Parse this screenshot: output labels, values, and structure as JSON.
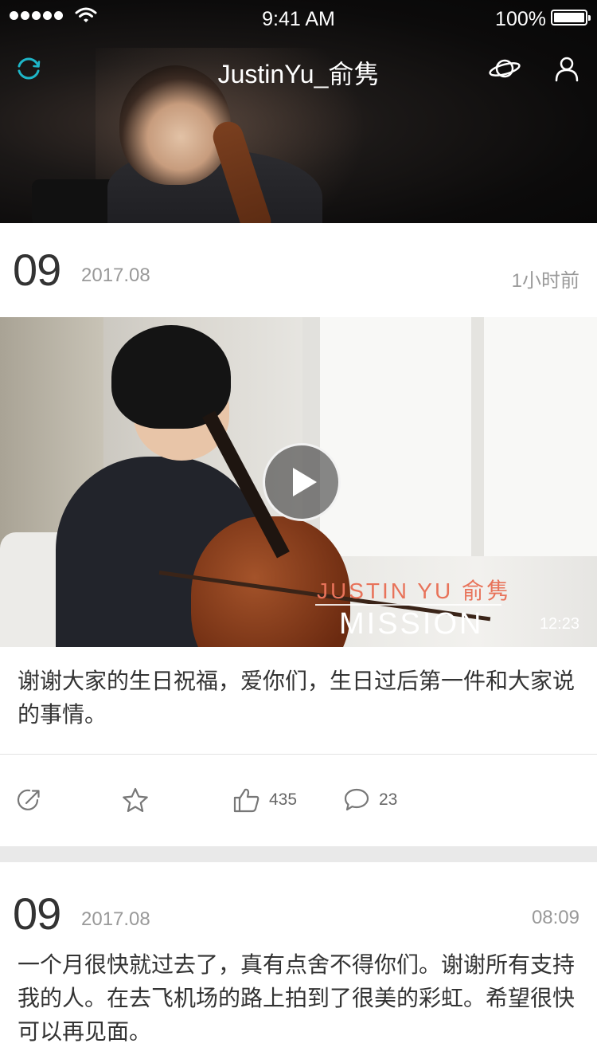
{
  "status_bar": {
    "time": "9:41 AM",
    "battery": "100%"
  },
  "nav": {
    "title": "JustinYu_俞隽",
    "icons": [
      "refresh-icon",
      "planet-icon",
      "user-icon"
    ]
  },
  "posts": [
    {
      "day": "09",
      "year_month": "2017.08",
      "time_ago": "1小时前",
      "video": {
        "brand": "JUSTIN YU 俞隽",
        "title": "MISSION",
        "duration": "12:23"
      },
      "caption": "谢谢大家的生日祝福，爱你们，生日过后第一件和大家说的事情。",
      "likes": "435",
      "comments": "23"
    },
    {
      "day": "09",
      "year_month": "2017.08",
      "time_ago": "08:09",
      "caption": "一个月很快就过去了，真有点舍不得你们。谢谢所有支持我的人。在去飞机场的路上拍到了很美的彩虹。希望很快可以再见面。"
    }
  ],
  "colors": {
    "accent": "#1eb6c8",
    "brand_orange": "#e8735a",
    "text": "#333333",
    "muted": "#999999"
  }
}
